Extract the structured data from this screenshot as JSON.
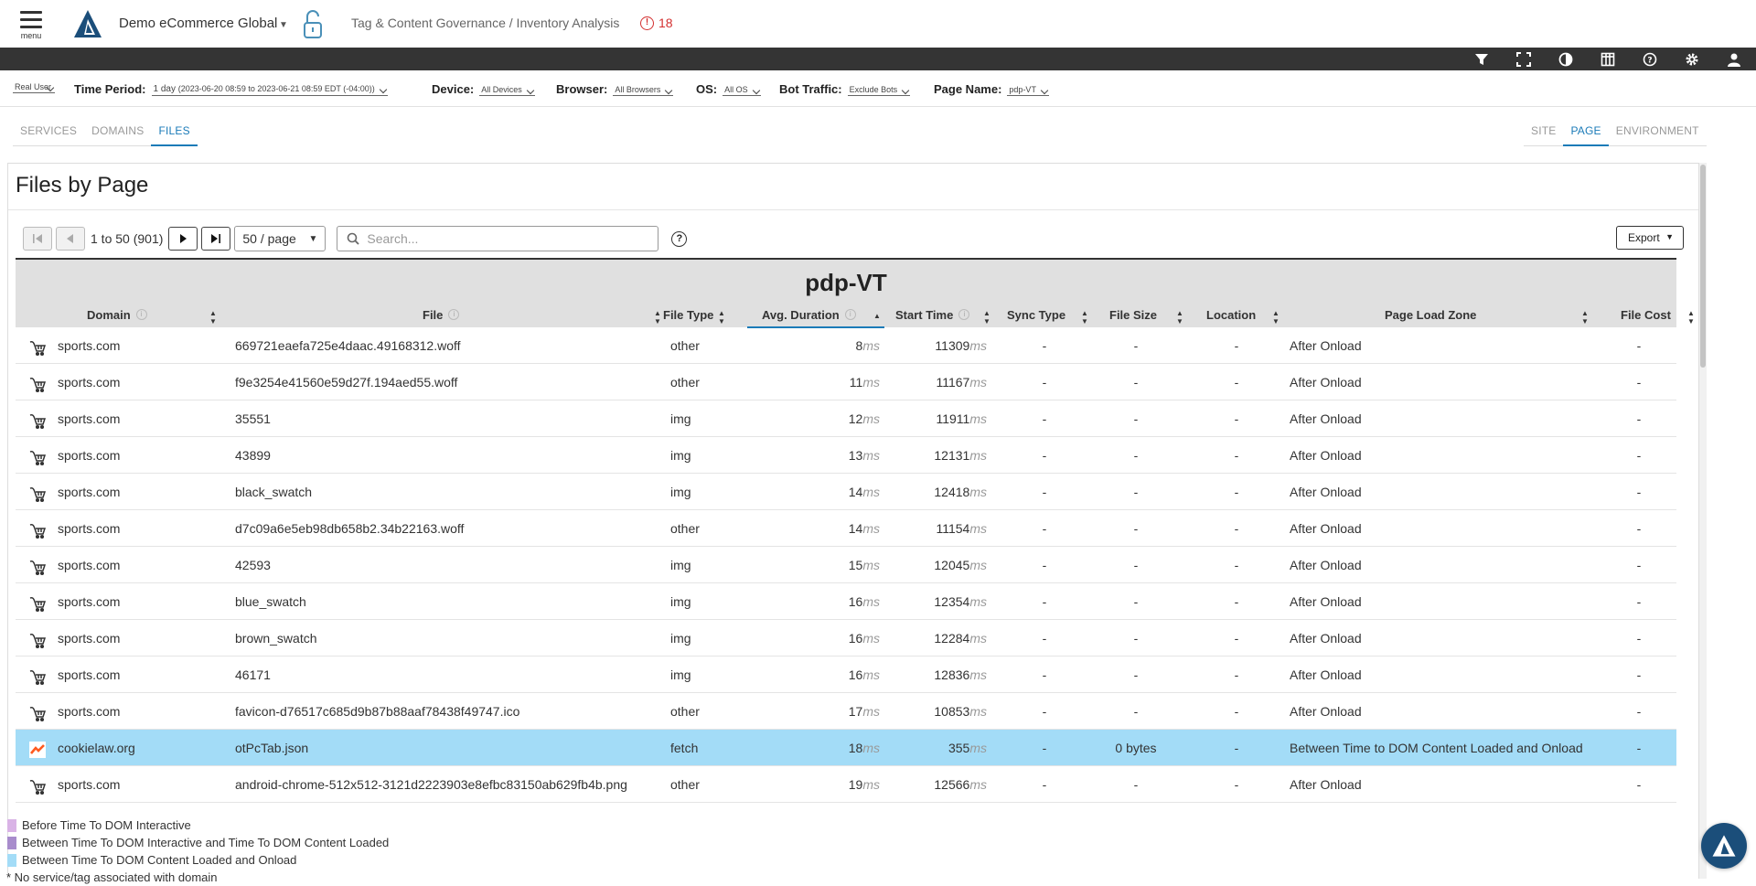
{
  "header": {
    "menu_label": "menu",
    "org_name": "Demo eCommerce Global",
    "breadcrumb": "Tag & Content Governance / Inventory Analysis",
    "alert_count": "18",
    "brand_color": "#1b4e7a",
    "alert_color": "#d32f2f"
  },
  "toolbar": {
    "icons": [
      "filter-icon",
      "fullscreen-icon",
      "contrast-icon",
      "columns-icon",
      "help-icon",
      "settings-icon",
      "user-icon"
    ]
  },
  "filters": {
    "mode": "Real User",
    "time_period_label": "Time Period:",
    "time_period_value": "1 day",
    "time_period_range": "(2023-06-20 08:59 to 2023-06-21 08:59 EDT (-04:00))",
    "device_label": "Device:",
    "device_value": "All Devices",
    "browser_label": "Browser:",
    "browser_value": "All Browsers",
    "os_label": "OS:",
    "os_value": "All OS",
    "bot_label": "Bot Traffic:",
    "bot_value": "Exclude Bots",
    "page_label": "Page Name:",
    "page_value": "pdp-VT"
  },
  "tabs_left": [
    "SERVICES",
    "DOMAINS",
    "FILES"
  ],
  "tabs_right": [
    "SITE",
    "PAGE",
    "ENVIRONMENT"
  ],
  "panel": {
    "title": "Files by Page",
    "pager_text": "1 to 50 (901)",
    "page_size": "50 / page",
    "search_placeholder": "Search...",
    "export_label": "Export",
    "table_title": "pdp-VT"
  },
  "columns": [
    "Domain",
    "File",
    "File Type",
    "Avg. Duration",
    "Start Time",
    "Sync Type",
    "File Size",
    "Location",
    "Page Load Zone",
    "File Cost"
  ],
  "unit_ms": "ms",
  "rows": [
    {
      "domain": "sports.com",
      "file": "669721eaefa725e4daac.49168312.woff",
      "type": "other",
      "dur": "8",
      "start": "11309",
      "sync": "-",
      "size": "-",
      "loc": "-",
      "zone": "After Onload",
      "cost": "-",
      "icon": "shopping-cart-icon"
    },
    {
      "domain": "sports.com",
      "file": "f9e3254e41560e59d27f.194aed55.woff",
      "type": "other",
      "dur": "11",
      "start": "11167",
      "sync": "-",
      "size": "-",
      "loc": "-",
      "zone": "After Onload",
      "cost": "-",
      "icon": "shopping-cart-icon"
    },
    {
      "domain": "sports.com",
      "file": "35551",
      "type": "img",
      "dur": "12",
      "start": "11911",
      "sync": "-",
      "size": "-",
      "loc": "-",
      "zone": "After Onload",
      "cost": "-",
      "icon": "shopping-cart-icon"
    },
    {
      "domain": "sports.com",
      "file": "43899",
      "type": "img",
      "dur": "13",
      "start": "12131",
      "sync": "-",
      "size": "-",
      "loc": "-",
      "zone": "After Onload",
      "cost": "-",
      "icon": "shopping-cart-icon"
    },
    {
      "domain": "sports.com",
      "file": "black_swatch",
      "type": "img",
      "dur": "14",
      "start": "12418",
      "sync": "-",
      "size": "-",
      "loc": "-",
      "zone": "After Onload",
      "cost": "-",
      "icon": "shopping-cart-icon"
    },
    {
      "domain": "sports.com",
      "file": "d7c09a6e5eb98db658b2.34b22163.woff",
      "type": "other",
      "dur": "14",
      "start": "11154",
      "sync": "-",
      "size": "-",
      "loc": "-",
      "zone": "After Onload",
      "cost": "-",
      "icon": "shopping-cart-icon"
    },
    {
      "domain": "sports.com",
      "file": "42593",
      "type": "img",
      "dur": "15",
      "start": "12045",
      "sync": "-",
      "size": "-",
      "loc": "-",
      "zone": "After Onload",
      "cost": "-",
      "icon": "shopping-cart-icon"
    },
    {
      "domain": "sports.com",
      "file": "blue_swatch",
      "type": "img",
      "dur": "16",
      "start": "12354",
      "sync": "-",
      "size": "-",
      "loc": "-",
      "zone": "After Onload",
      "cost": "-",
      "icon": "shopping-cart-icon"
    },
    {
      "domain": "sports.com",
      "file": "brown_swatch",
      "type": "img",
      "dur": "16",
      "start": "12284",
      "sync": "-",
      "size": "-",
      "loc": "-",
      "zone": "After Onload",
      "cost": "-",
      "icon": "shopping-cart-icon"
    },
    {
      "domain": "sports.com",
      "file": "46171",
      "type": "img",
      "dur": "16",
      "start": "12836",
      "sync": "-",
      "size": "-",
      "loc": "-",
      "zone": "After Onload",
      "cost": "-",
      "icon": "shopping-cart-icon"
    },
    {
      "domain": "sports.com",
      "file": "favicon-d76517c685d9b87b88aaf78438f49747.ico",
      "type": "other",
      "dur": "17",
      "start": "10853",
      "sync": "-",
      "size": "-",
      "loc": "-",
      "zone": "After Onload",
      "cost": "-",
      "icon": "shopping-cart-icon"
    },
    {
      "domain": "cookielaw.org",
      "file": "otPcTab.json",
      "type": "fetch",
      "dur": "18",
      "start": "355",
      "sync": "-",
      "size": "0 bytes",
      "loc": "-",
      "zone": "Between Time to DOM Content Loaded and Onload",
      "cost": "-",
      "icon": "cookielaw-icon",
      "highlight": true
    },
    {
      "domain": "sports.com",
      "file": "android-chrome-512x512-3121d2223903e8efbc83150ab629fb4b.png",
      "type": "other",
      "dur": "19",
      "start": "12566",
      "sync": "-",
      "size": "-",
      "loc": "-",
      "zone": "After Onload",
      "cost": "-",
      "icon": "shopping-cart-icon"
    }
  ],
  "legend": [
    {
      "label": "Before Time To DOM Interactive",
      "color": "#d9b3e6"
    },
    {
      "label": "Between Time To DOM Interactive and Time To DOM Content Loaded",
      "color": "#a88ccc"
    },
    {
      "label": "Between Time To DOM Content Loaded and Onload",
      "color": "#a3dcf7"
    }
  ],
  "legend_note": "* No service/tag associated with domain"
}
